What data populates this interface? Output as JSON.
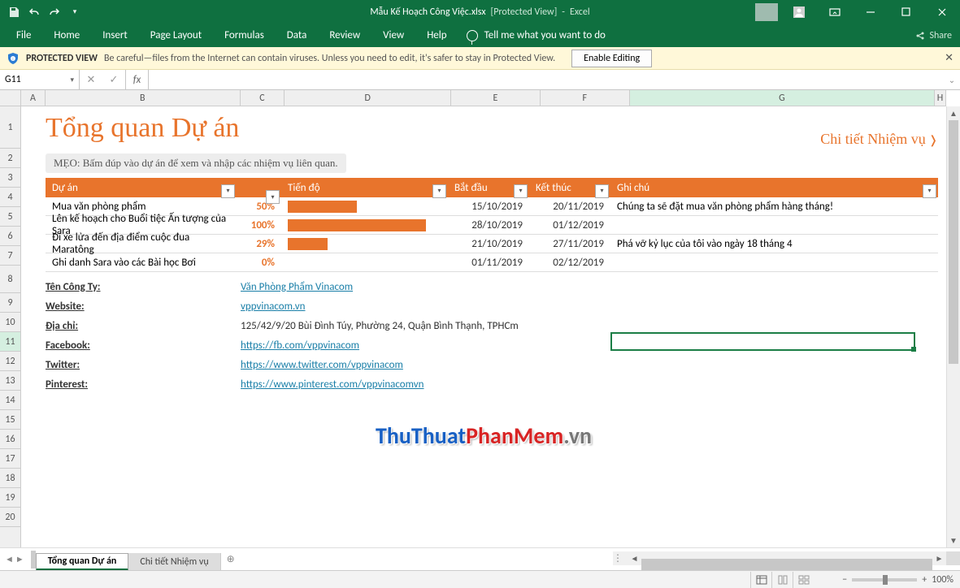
{
  "titlebar": {
    "filename": "Mẫu Kế Hoạch Công Việc.xlsx",
    "mode": "[Protected View]",
    "app": "Excel",
    "share": "Share"
  },
  "ribbon": {
    "tabs": [
      "File",
      "Home",
      "Insert",
      "Page Layout",
      "Formulas",
      "Data",
      "Review",
      "View",
      "Help"
    ],
    "tellme": "Tell me what you want to do"
  },
  "protected": {
    "label": "PROTECTED VIEW",
    "msg": "Be careful—files from the Internet can contain viruses. Unless you need to edit, it's safer to stay in Protected View.",
    "enable": "Enable Editing"
  },
  "namebox": "G11",
  "columns": [
    "A",
    "B",
    "C",
    "D",
    "E",
    "F",
    "G",
    "H"
  ],
  "rows": [
    1,
    2,
    3,
    4,
    5,
    6,
    7,
    8,
    9,
    10,
    11,
    12,
    13,
    14,
    15,
    16,
    17,
    18,
    19,
    20
  ],
  "sheet": {
    "title": "Tổng quan Dự án",
    "link": "Chi tiết Nhiệm vụ",
    "tip": "MẸO: Bấm đúp vào dự án để xem và nhập các nhiệm vụ liên quan.",
    "headers": {
      "project": "Dự án",
      "progress": "Tiến độ",
      "start": "Bắt đầu",
      "end": "Kết thúc",
      "note": "Ghi chú"
    },
    "rows": [
      {
        "project": "Mua văn phòng phẩm",
        "pct": "50%",
        "bar": 50,
        "start": "15/10/2019",
        "end": "20/11/2019",
        "note": "Chúng ta sẽ đặt mua văn phòng phẩm hàng tháng!"
      },
      {
        "project": "Lên kế hoạch cho Buổi tiệc Ấn tượng của Sara",
        "pct": "100%",
        "bar": 100,
        "start": "28/10/2019",
        "end": "01/12/2019",
        "note": ""
      },
      {
        "project": "Đi xe lửa đến địa điểm cuộc đua Maratông",
        "pct": "29%",
        "bar": 29,
        "start": "21/10/2019",
        "end": "27/11/2019",
        "note": "Phá vỡ kỷ lục của tôi vào ngày 18 tháng 4"
      },
      {
        "project": "Ghi danh Sara vào các Bài học Bơi",
        "pct": "0%",
        "bar": 0,
        "start": "01/11/2019",
        "end": "02/12/2019",
        "note": ""
      }
    ],
    "info": [
      {
        "label": "Tên Công Ty:",
        "value": "Văn Phòng Phẩm Vinacom",
        "link": true
      },
      {
        "label": "Website:",
        "value": "vppvinacom.vn",
        "link": true
      },
      {
        "label": "Địa chỉ:",
        "value": "125/42/9/20 Bùi Đình Túy, Phường 24, Quận Bình Thạnh, TPHCm",
        "link": false
      },
      {
        "label": "Facebook:",
        "value": "https://fb.com/vppvinacom",
        "link": true
      },
      {
        "label": "Twitter:",
        "value": "https://www.twitter.com/vppvinacom",
        "link": true
      },
      {
        "label": "Pinterest:",
        "value": "https://www.pinterest.com/vppvinacomvn",
        "link": true
      }
    ],
    "watermark": {
      "a": "ThuThuat",
      "b": "PhanMem",
      "c": ".vn"
    }
  },
  "tabs": {
    "active": "Tổng quan Dự án",
    "inactive": "Chi tiết Nhiệm vụ"
  },
  "status": {
    "zoom": "100%"
  }
}
